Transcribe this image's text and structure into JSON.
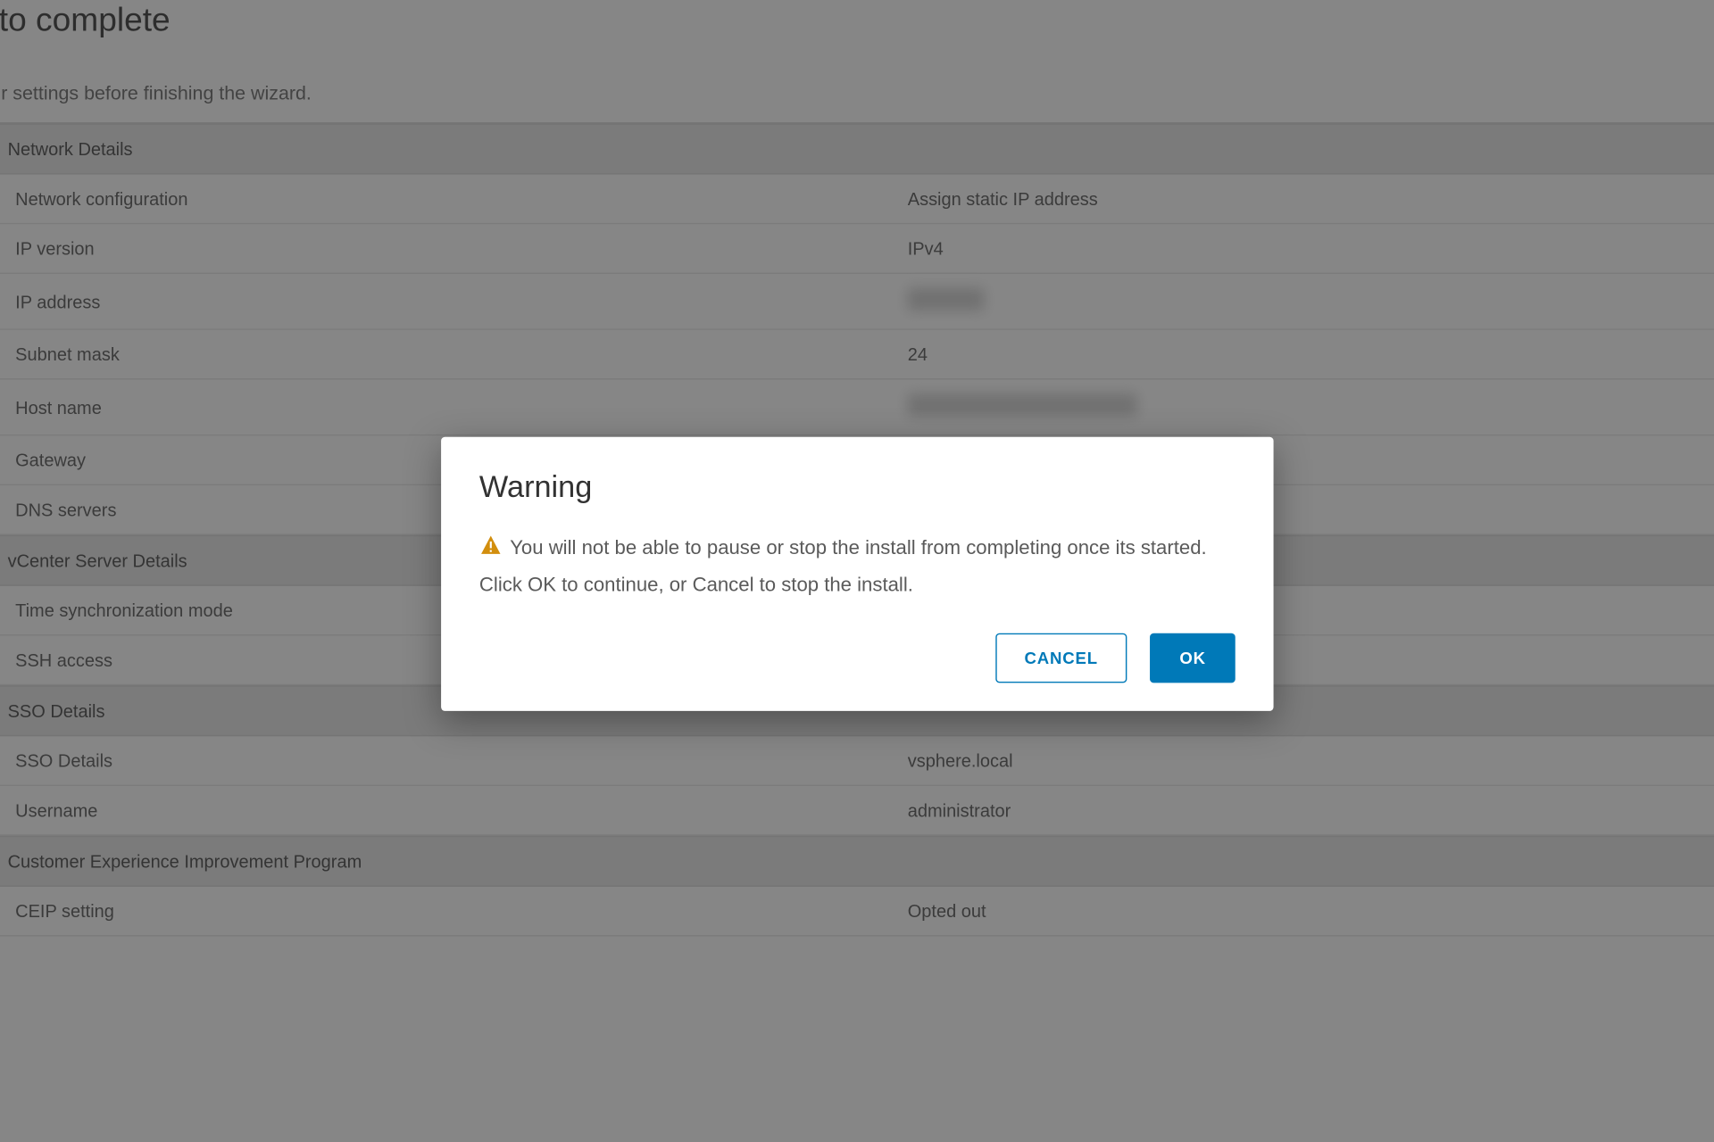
{
  "page": {
    "title": "ady to complete",
    "subtitle": "iew your settings before finishing the wizard."
  },
  "sections": {
    "network": {
      "header": "Network Details",
      "config_label": "Network configuration",
      "config_value": "Assign static IP address",
      "ipver_label": "IP version",
      "ipver_value": "IPv4",
      "ipaddr_label": "IP address",
      "subnet_label": "Subnet mask",
      "subnet_value": "24",
      "host_label": "Host name",
      "gateway_label": "Gateway",
      "dns_label": "DNS servers"
    },
    "vcenter": {
      "header": "vCenter Server Details",
      "time_label": "Time synchronization mode",
      "ssh_label": "SSH access"
    },
    "sso": {
      "header": "SSO Details",
      "domain_label": "SSO Details",
      "domain_value": "vsphere.local",
      "user_label": "Username",
      "user_value": "administrator"
    },
    "ceip": {
      "header": "Customer Experience Improvement Program",
      "setting_label": "CEIP setting",
      "setting_value": "Opted out"
    }
  },
  "modal": {
    "title": "Warning",
    "message": "You will not be able to pause or stop the install from completing once its started. Click OK to continue, or Cancel to stop the install.",
    "cancel": "CANCEL",
    "ok": "OK"
  }
}
